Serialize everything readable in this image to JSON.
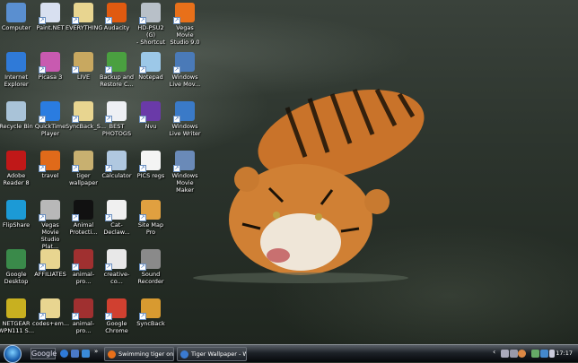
{
  "desktop_icons": [
    [
      {
        "label": "Computer",
        "color": "#5a8fd0"
      },
      {
        "label": "Internet\nExplorer",
        "color": "#2f7ad8"
      },
      {
        "label": "Recycle Bin",
        "color": "#a9c3d8"
      },
      {
        "label": "Adobe\nReader 8",
        "color": "#c01818"
      },
      {
        "label": "FlipShare",
        "color": "#1c9ad6"
      },
      {
        "label": "Google\nDesktop",
        "color": "#3a8a4a"
      },
      {
        "label": "NETGEAR\nWPN111 S...",
        "color": "#c8b020"
      }
    ],
    [
      {
        "label": "Paint.NET",
        "color": "#d8e0f0"
      },
      {
        "label": "Picasa 3",
        "color": "#c85ab0"
      },
      {
        "label": "QuickTime\nPlayer",
        "color": "#2a7ce0"
      },
      {
        "label": "travel",
        "color": "#e06a1a"
      },
      {
        "label": "Vegas Movie\nStudio Plat...",
        "color": "#b8b8b8"
      },
      {
        "label": "AFFILIATES",
        "color": "#e8d590"
      },
      {
        "label": "codes+em...",
        "color": "#e8d590"
      }
    ],
    [
      {
        "label": "EVERYTHING",
        "color": "#e8d590"
      },
      {
        "label": "LIVE",
        "color": "#c8a860"
      },
      {
        "label": "SyncBack_S...",
        "color": "#e8d590"
      },
      {
        "label": "tiger\nwallpaper",
        "color": "#c8b070"
      },
      {
        "label": "Animal\nProtecti...",
        "color": "#111111"
      },
      {
        "label": "animal-pro...",
        "color": "#a03030"
      },
      {
        "label": "animal-pro...",
        "color": "#a03030"
      }
    ],
    [
      {
        "label": "Audacity",
        "color": "#e05a10"
      },
      {
        "label": "Backup and\nRestore C...",
        "color": "#4aa040"
      },
      {
        "label": "BEST\nPHOTOGS",
        "color": "#eef0f4"
      },
      {
        "label": "Calculator",
        "color": "#b0c8e0"
      },
      {
        "label": "Cat-Declaw...",
        "color": "#f0f0f0"
      },
      {
        "label": "creative-co...",
        "color": "#e8e8e8"
      },
      {
        "label": "Google\nChrome",
        "color": "#d04030"
      }
    ],
    [
      {
        "label": "HD-PSU2 (G)\n- Shortcut",
        "color": "#b8c0c8"
      },
      {
        "label": "Notepad",
        "color": "#9cc8e8"
      },
      {
        "label": "Nvu",
        "color": "#6a3aa8"
      },
      {
        "label": "PICS regs",
        "color": "#f4f4f4"
      },
      {
        "label": "Site Map Pro",
        "color": "#e0a040"
      },
      {
        "label": "Sound\nRecorder",
        "color": "#8a8a8a"
      },
      {
        "label": "SyncBack",
        "color": "#d89a30"
      }
    ],
    [
      {
        "label": "Vegas Movie\nStudio 9.0",
        "color": "#e8701a"
      },
      {
        "label": "Windows\nLive Mov...",
        "color": "#4a7ab8"
      },
      {
        "label": "Windows\nLive Writer",
        "color": "#3a7ac8"
      },
      {
        "label": "Windows\nMovie Maker",
        "color": "#6a8ab8"
      }
    ]
  ],
  "taskbar": {
    "search_label": "Google",
    "overflow": "»",
    "tasks": [
      {
        "label": "Swimming tiger on ...",
        "color": "#e8701a"
      },
      {
        "label": "Tiger Wallpaper - W...",
        "color": "#3a7ad0"
      }
    ],
    "tray_expand": "‹",
    "clock": "17:17"
  }
}
